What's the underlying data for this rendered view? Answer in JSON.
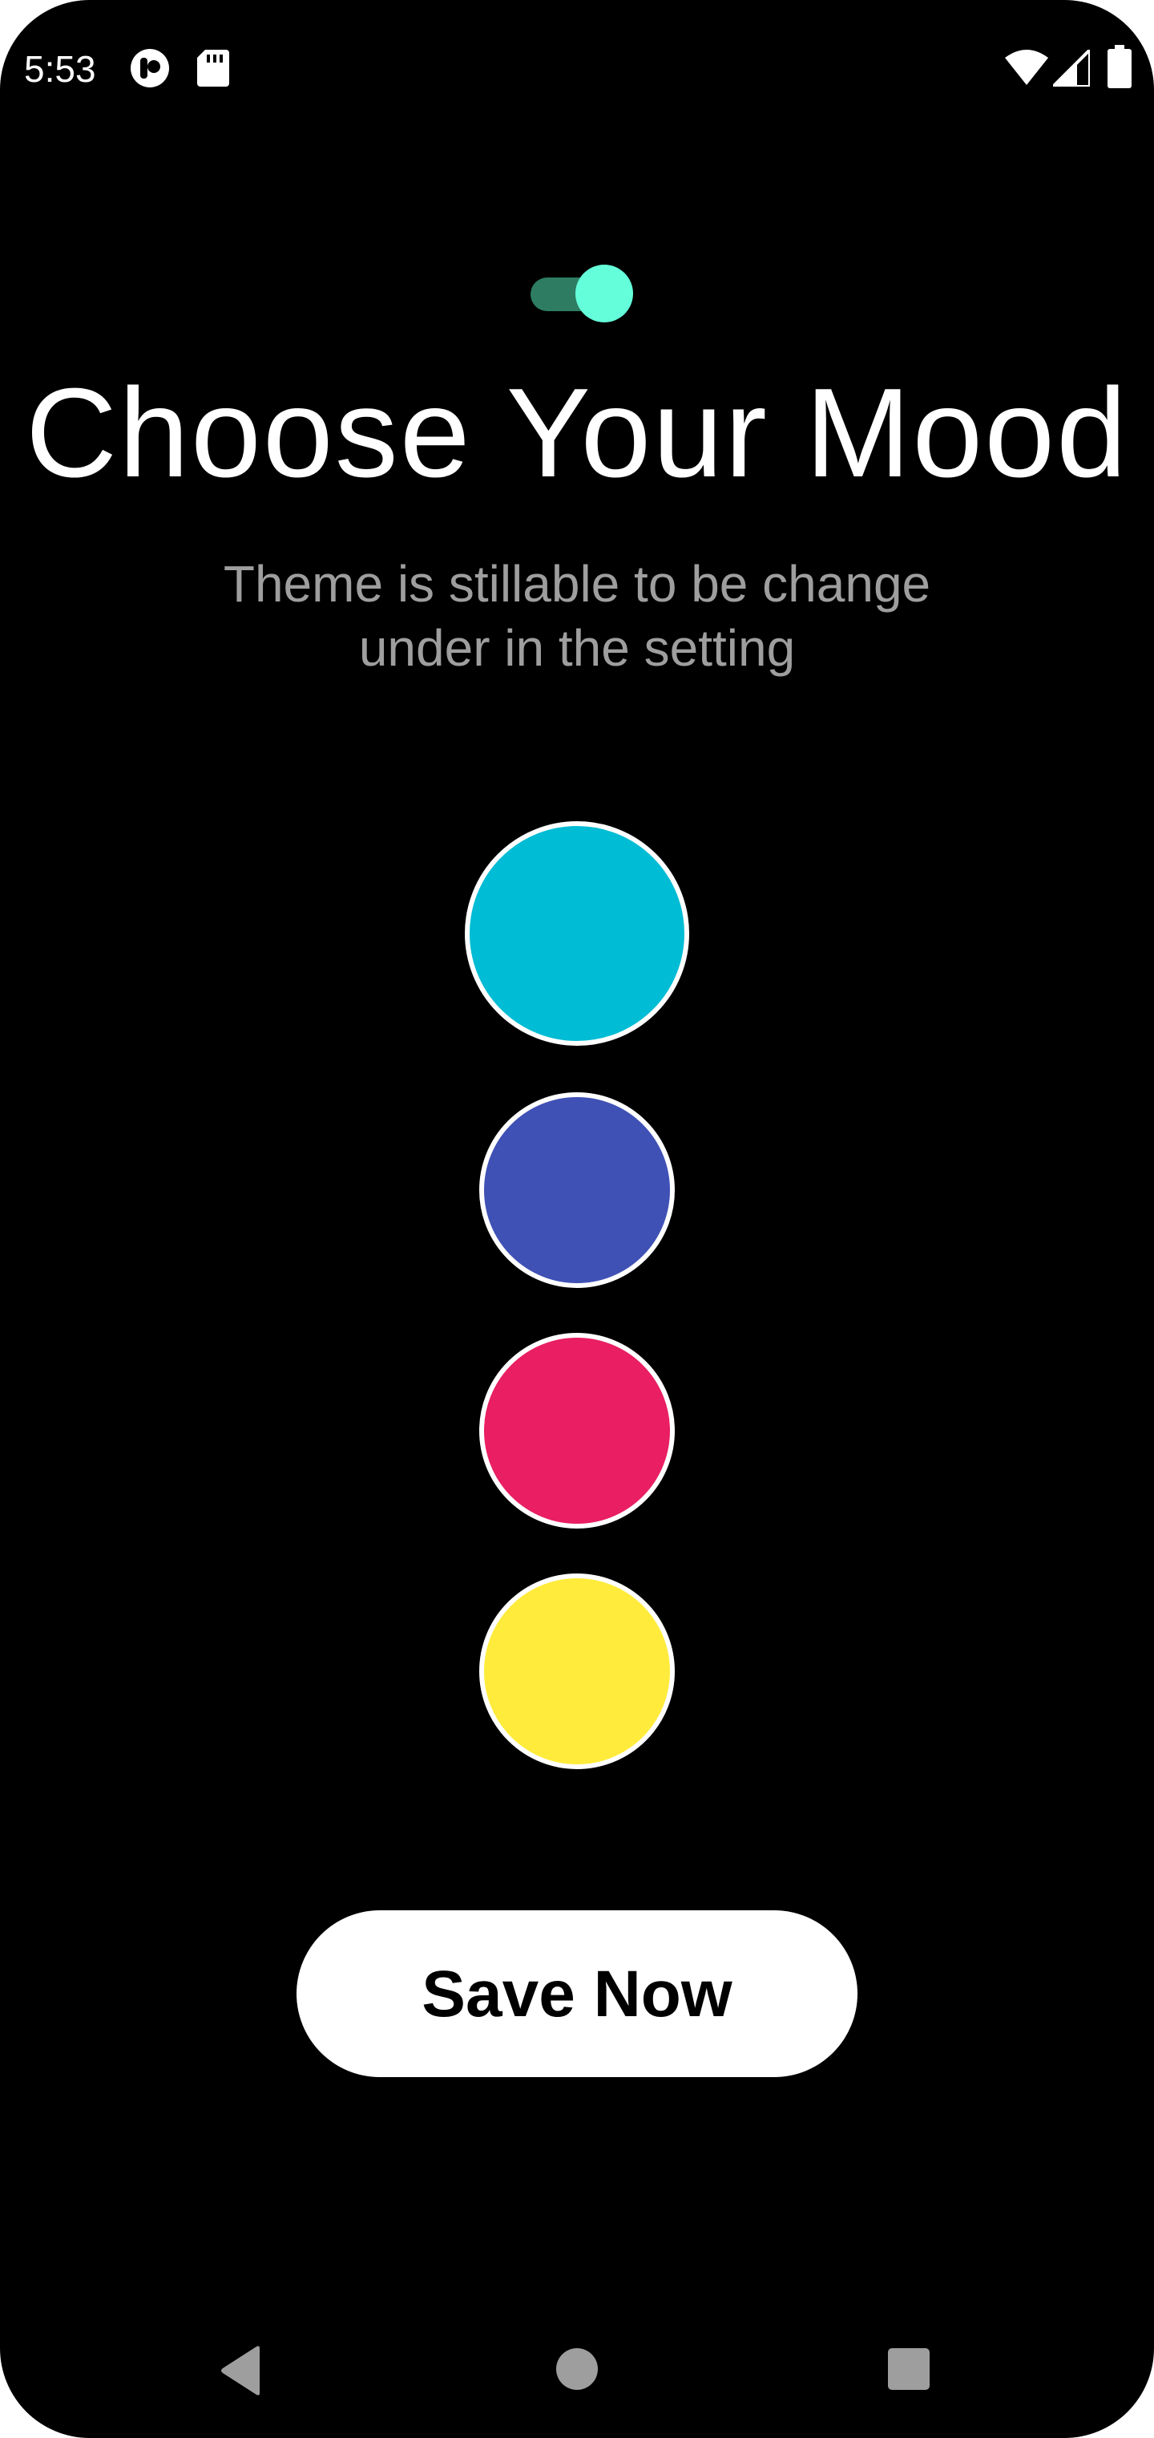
{
  "status_bar": {
    "time": "5:53",
    "left_icons": [
      "app-notification-icon",
      "sd-card-icon"
    ],
    "right_icons": [
      "wifi-icon",
      "cellular-signal-icon",
      "battery-icon"
    ]
  },
  "theme_toggle": {
    "state": "on",
    "track_color": "#2e7d63",
    "thumb_color": "#64ffda"
  },
  "header": {
    "title": "Choose Your Mood",
    "subtitle_line1": "Theme is stillable to be change",
    "subtitle_line2": "under in the setting"
  },
  "moods": [
    {
      "name": "cyan",
      "color": "#00bcd4",
      "selected": true
    },
    {
      "name": "indigo",
      "color": "#3f51b5",
      "selected": false
    },
    {
      "name": "pink",
      "color": "#e91e63",
      "selected": false
    },
    {
      "name": "yellow",
      "color": "#ffeb3b",
      "selected": false
    }
  ],
  "actions": {
    "save_label": "Save Now"
  },
  "nav_bar": {
    "icons": [
      "back-icon",
      "home-icon",
      "recents-icon"
    ]
  }
}
